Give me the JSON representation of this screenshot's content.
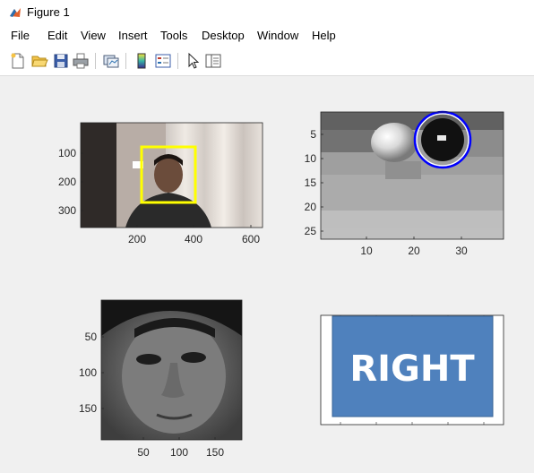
{
  "window": {
    "title": "Figure 1"
  },
  "menu": [
    "File",
    "Edit",
    "View",
    "Insert",
    "Tools",
    "Desktop",
    "Window",
    "Help"
  ],
  "toolbar": [
    {
      "name": "new-figure-button",
      "icon": "new-file-icon"
    },
    {
      "name": "open-file-button",
      "icon": "folder-open-icon"
    },
    {
      "name": "save-button",
      "icon": "save-disk-icon"
    },
    {
      "name": "print-button",
      "icon": "printer-icon"
    },
    {
      "name": "link-plot-button",
      "icon": "link-plot-icon"
    },
    {
      "name": "insert-colorbar-button",
      "icon": "colorbar-icon"
    },
    {
      "name": "insert-legend-button",
      "icon": "legend-icon"
    },
    {
      "name": "edit-plot-button",
      "icon": "arrow-pointer-icon"
    },
    {
      "name": "property-inspector-button",
      "icon": "property-panel-icon"
    }
  ],
  "axes": {
    "face_detection": {
      "image": "webcam frame with face bounding box",
      "bbox_color": "#ffff00",
      "xticks": [
        "200",
        "400",
        "600"
      ],
      "yticks": [
        "100",
        "200",
        "300"
      ]
    },
    "eye_crop": {
      "image": "grayscale eye crop with detected pupil circle",
      "circle_color": "#0000ff",
      "xticks": [
        "10",
        "20",
        "30"
      ],
      "yticks": [
        "5",
        "10",
        "15",
        "20",
        "25"
      ]
    },
    "face_crop": {
      "image": "grayscale face crop",
      "xticks": [
        "50",
        "100",
        "150"
      ],
      "yticks": [
        "50",
        "100",
        "150"
      ]
    },
    "direction": {
      "label": "RIGHT",
      "box_color": "#4f81bd",
      "text_color": "#ffffff"
    }
  }
}
